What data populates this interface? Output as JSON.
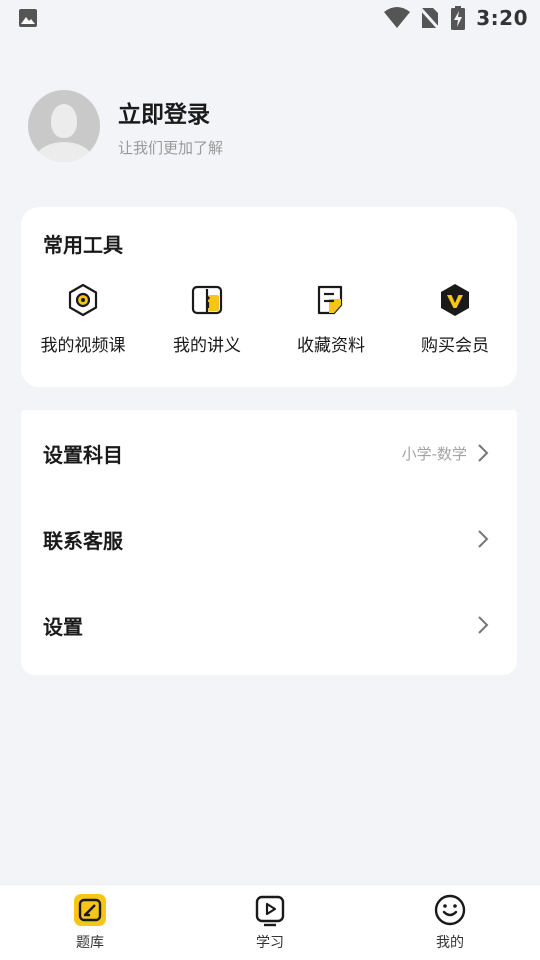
{
  "status_bar": {
    "time": "3:20",
    "icons": [
      "image-notification-icon",
      "wifi-icon",
      "no-sim-icon",
      "battery-charging-icon"
    ]
  },
  "profile": {
    "title": "立即登录",
    "subtitle": "让我们更加了解"
  },
  "tools": {
    "title": "常用工具",
    "items": [
      {
        "label": "我的视频课",
        "icon": "video-course-icon"
      },
      {
        "label": "我的讲义",
        "icon": "handout-book-icon"
      },
      {
        "label": "收藏资料",
        "icon": "favorite-materials-icon"
      },
      {
        "label": "购买会员",
        "icon": "vip-membership-icon"
      }
    ]
  },
  "menu": {
    "items": [
      {
        "label": "设置科目",
        "value": "小学-数学"
      },
      {
        "label": "联系客服",
        "value": ""
      },
      {
        "label": "设置",
        "value": ""
      }
    ]
  },
  "bottom_nav": {
    "items": [
      {
        "label": "题库",
        "icon": "question-bank-icon",
        "active": true
      },
      {
        "label": "学习",
        "icon": "study-video-icon",
        "active": false
      },
      {
        "label": "我的",
        "icon": "profile-smile-icon",
        "active": false
      }
    ]
  },
  "colors": {
    "accent": "#f5c518",
    "background": "#f3f4f8",
    "card": "#ffffff",
    "text": "#1a1a1a",
    "muted": "#9a9a9a"
  }
}
